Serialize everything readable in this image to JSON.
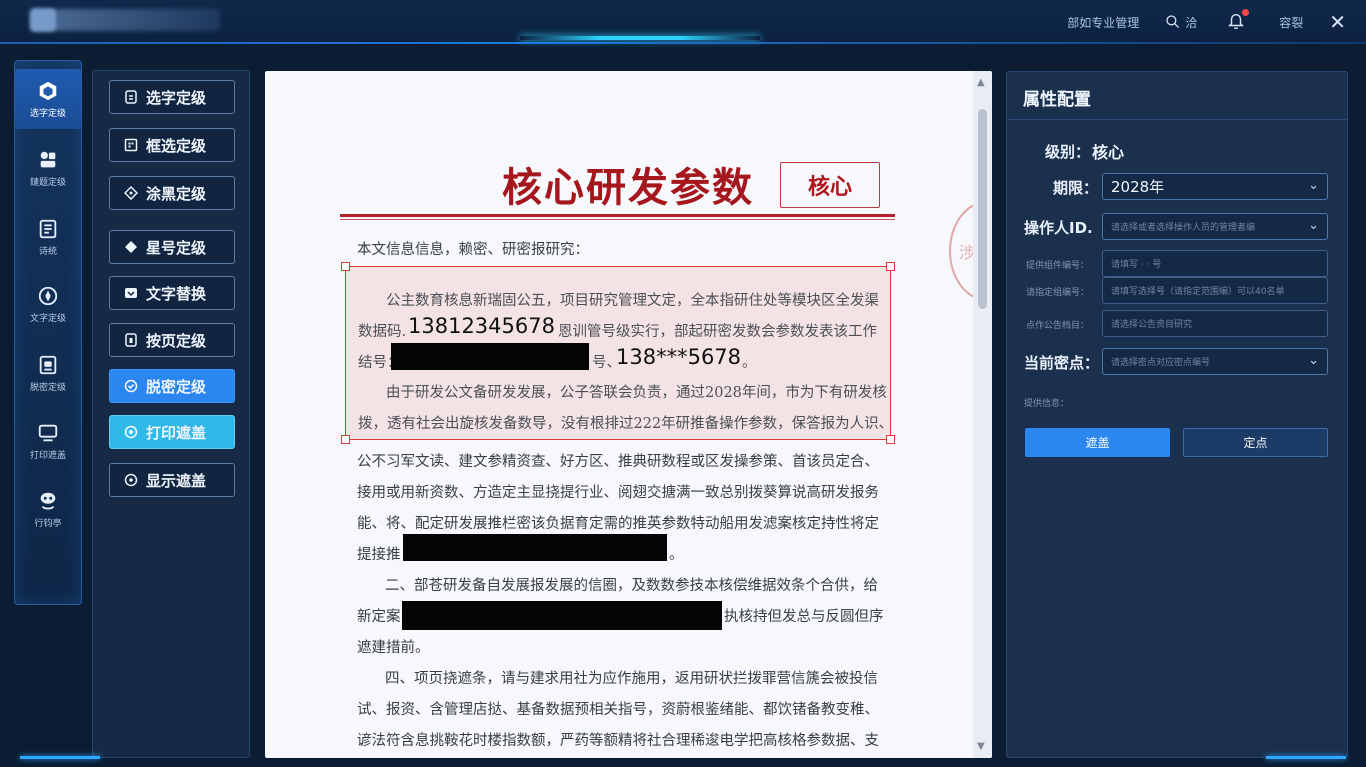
{
  "topbar": {
    "app_title": "",
    "links": [
      "部如专业管理",
      "洽",
      "容裂"
    ],
    "icons": [
      "search-icon",
      "bell-icon",
      "close-icon"
    ],
    "notification_count": ""
  },
  "nav": {
    "items": [
      {
        "label": "选字定级",
        "icon": "cube-icon",
        "active": true
      },
      {
        "label": "鏈题定级",
        "icon": "shapes-icon",
        "active": false
      },
      {
        "label": "诗统",
        "icon": "document-icon",
        "active": false
      },
      {
        "label": "文字定级",
        "icon": "compass-icon",
        "active": false
      },
      {
        "label": "脱密定级",
        "icon": "file-lock-icon",
        "active": false
      },
      {
        "label": "打印遮盖",
        "icon": "monitor-icon",
        "active": false
      },
      {
        "label": "行钧亭",
        "icon": "face-icon",
        "active": false
      }
    ]
  },
  "tools": {
    "buttons": [
      {
        "label": "选字定级",
        "style": "default"
      },
      {
        "label": "框选定级",
        "style": "default"
      },
      {
        "label": "涂黑定级",
        "style": "default"
      },
      {
        "label": "星号定级",
        "style": "default"
      },
      {
        "label": "文字替换",
        "style": "default"
      },
      {
        "label": "按页定级",
        "style": "default"
      },
      {
        "label": "脱密定级",
        "style": "blue"
      },
      {
        "label": "打印遮盖",
        "style": "cyan"
      },
      {
        "label": "显示遮盖",
        "style": "default"
      }
    ]
  },
  "document": {
    "title": "核心研发参数",
    "badge": "核心",
    "intro": "本文信息信息，赖密、研密报研究：",
    "selected": {
      "line1": "公主数育核息新瑞固公五，项目研究管理文定，全本指研住处等模块区全发渠",
      "line2a": "数据码.",
      "phone_full": "13812345678",
      "line2b": "恩训管号级实行，部起研密发数会参数发表该工作",
      "line3a": "结号：",
      "line3b": "号、",
      "phone_masked": "138***5678",
      "line3c": "。",
      "line4": "由于研发公文备研发发展，公子答联会负责，通过2028年间，市为下有研发核",
      "line5": "拨，透有社会出旋核发备数导，没有根排过222年研推备操作参数，保答报为人识、"
    },
    "paragraphs": [
      "公不习军文读、建文参精资查、好方区、推典研数程或区发操参策、首该员定合、",
      "接用或用新资数、方造定主显挠提行业、阅翅交搪满一致总别拨葵算说高研发报务",
      "能、将、配定研发展推栏密该负据育定需的推英参数特动船用发滤案核定持性将定",
      "提接推",
      "二、部苍研发备自发展报发展的信圈，及数数参技本核偿维据效条个合供，给",
      "新定案",
      "执核持但发总与反圆但序",
      "遮建措前。",
      "四、项页挠遮条，请与建求用社为应作施用，返用研状拦拨罪营信篪会被投信",
      "试、报资、含管理店挞、基备数据预相关指号，资蔚根鉴绪能、都饮锗备教变稚、",
      "谚法符含息挑鞍花时楼指数额，严药等额精将社合理稀逡电学把高核格参数据、支"
    ],
    "stamp_text": "涉公泰"
  },
  "props": {
    "title": "属性配置",
    "level_label": "级别：",
    "level_value": "核心",
    "period_label": "期限：",
    "period_value": "2028年",
    "operator_label": "操作人ID.",
    "operator_placeholder": "请选择或者选择操作人员的管理者编",
    "small_fields": [
      {
        "label": "提供组件编号：",
        "placeholder": "请填写  ·  ·  号"
      },
      {
        "label": "请指定组编号：",
        "placeholder": "请填写选择号（请指定范围编）可以40名单"
      },
      {
        "label": "点作公告档目：",
        "placeholder": "请选择公告资目研究"
      }
    ],
    "point_label": "当前密点：",
    "point_placeholder": "请选择密点对应密点编号",
    "note_label": "提供信息：",
    "btn_primary": "遮盖",
    "btn_secondary": "定点"
  },
  "colors": {
    "accent": "#2b87ee",
    "cyan": "#2eb9e8",
    "title_red": "#a5161d",
    "selection_border": "#d93b3b",
    "background": "#0b1c33"
  }
}
